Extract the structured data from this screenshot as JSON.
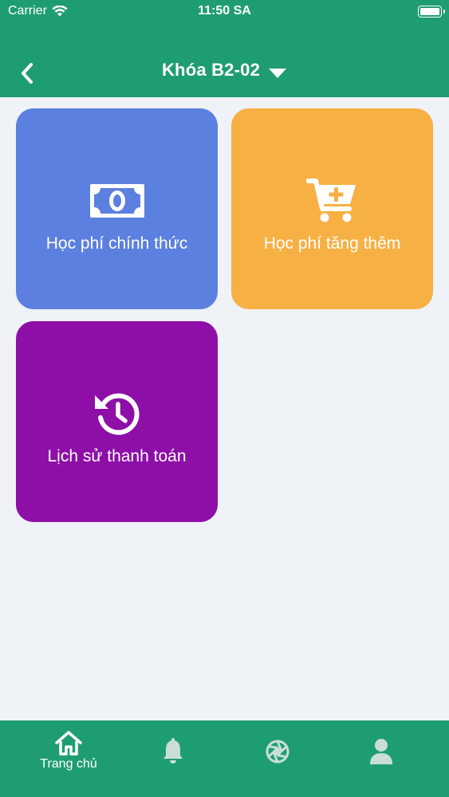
{
  "status_bar": {
    "carrier": "Carrier",
    "time": "11:50 SA",
    "battery_level": 1.0
  },
  "header": {
    "title": "Khóa B2-02",
    "back_icon": "chevron-left-icon",
    "dropdown_icon": "caret-down-icon",
    "background_color": "#1f9d72"
  },
  "tiles": [
    {
      "label": "Học phí chính thức",
      "icon": "money-bill-icon",
      "color": "#5c80e0"
    },
    {
      "label": "Học phí tăng thêm",
      "icon": "cart-plus-icon",
      "color": "#f7b044"
    },
    {
      "label": "Lịch sử thanh toán",
      "icon": "history-icon",
      "color": "#8e0ea8"
    }
  ],
  "bottom_nav": {
    "items": [
      {
        "label": "Trang chủ",
        "icon": "home-icon",
        "active": true
      },
      {
        "label": "",
        "icon": "bell-icon",
        "active": false
      },
      {
        "label": "",
        "icon": "aperture-icon",
        "active": false
      },
      {
        "label": "",
        "icon": "user-icon",
        "active": false
      }
    ],
    "active_color": "#ffffff",
    "inactive_color": "#c9dfd6"
  }
}
